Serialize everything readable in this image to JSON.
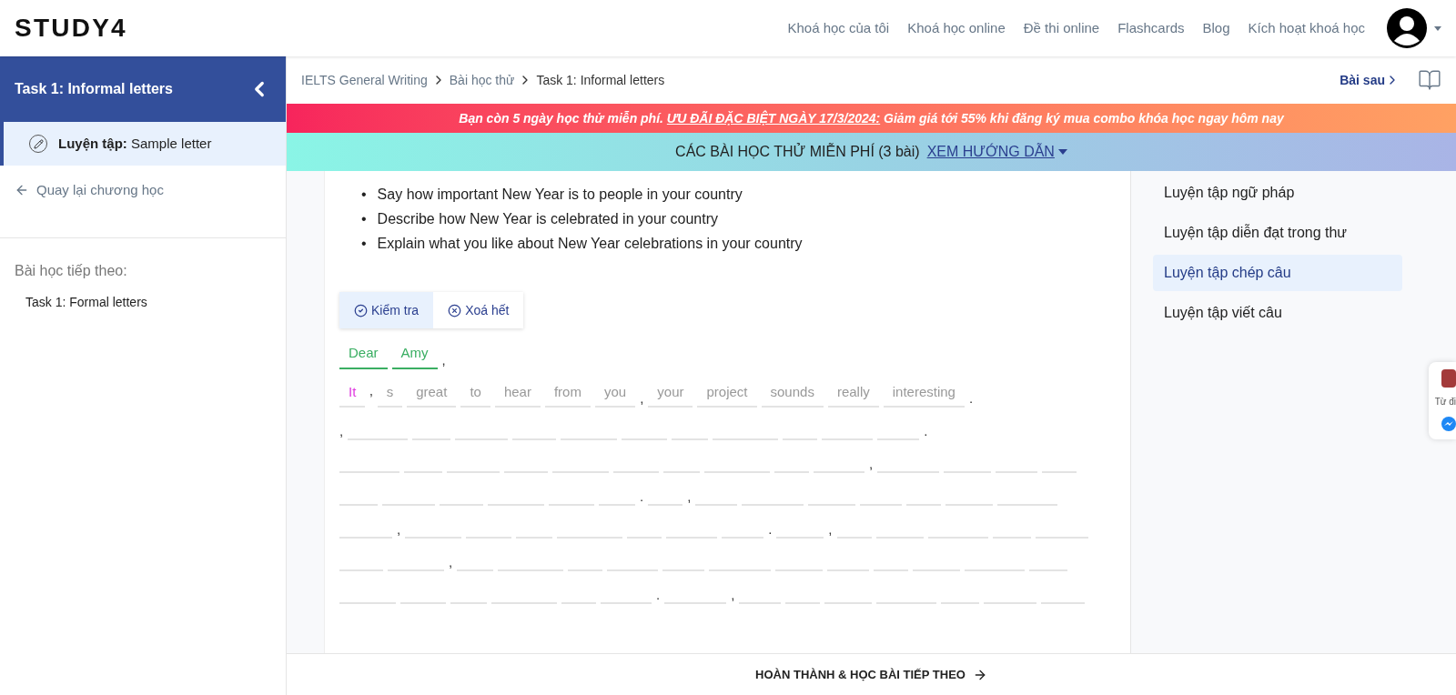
{
  "header": {
    "logo": "STUDY4",
    "nav": [
      "Khoá học của tôi",
      "Khoá học online",
      "Đề thi online",
      "Flashcards",
      "Blog",
      "Kích hoạt khoá học"
    ]
  },
  "sidebar": {
    "title": "Task 1: Informal letters",
    "items": [
      {
        "label": "Luyện tập:",
        "text": "Sample letter",
        "selected": true
      }
    ],
    "back": "Quay lại chương học",
    "next_heading": "Bài học tiếp theo:",
    "next_items": [
      "Task 1: Formal letters"
    ]
  },
  "breadcrumb": [
    "IELTS General Writing",
    "Bài học thử",
    "Task 1: Informal letters"
  ],
  "next_link": "Bài sau",
  "promo": {
    "text": "Bạn còn 5 ngày học thử miễn phí. ",
    "link": "ƯU ĐÃI ĐẶC BIỆT NGÀY 17/3/2024:",
    "rest": " Giảm giá tới 55% khi đăng ký mua combo khóa học ngay hôm nay"
  },
  "trial_bar": {
    "text": "CÁC BÀI HỌC THỬ MIỄN PHÍ (3 bài)",
    "link": "XEM HƯỚNG DẪN"
  },
  "bullets": [
    {
      "marker": "•",
      "text": "Say how important New Year is to people in your country"
    },
    {
      "marker": "•",
      "text": "Describe how New Year is celebrated in your country"
    },
    {
      "marker": "•",
      "text": "Explain what you like about New Year celebrations in your country"
    }
  ],
  "actions": [
    {
      "label": "Kiểm tra",
      "kind": "check",
      "selected": true
    },
    {
      "label": "Xoá hết",
      "kind": "clear",
      "selected": false
    }
  ],
  "lines": [
    [
      {
        "kind": "word",
        "text": "Dear",
        "correct": true,
        "active": false
      },
      {
        "kind": "word",
        "text": "Amy",
        "correct": true,
        "active": false
      },
      {
        "kind": "mark",
        "text": ","
      }
    ],
    [
      {
        "kind": "word",
        "text": "It",
        "correct": false,
        "active": true
      },
      {
        "kind": "mark",
        "text": "’"
      },
      {
        "kind": "word",
        "text": "s",
        "correct": false,
        "active": false
      },
      {
        "kind": "word",
        "text": "great",
        "correct": false,
        "active": false
      },
      {
        "kind": "word",
        "text": "to",
        "correct": false,
        "active": false
      },
      {
        "kind": "word",
        "text": "hear",
        "correct": false,
        "active": false
      },
      {
        "kind": "word",
        "text": "from",
        "correct": false,
        "active": false
      },
      {
        "kind": "word",
        "text": "you",
        "correct": false,
        "active": false
      },
      {
        "kind": "mark",
        "text": ","
      },
      {
        "kind": "word",
        "text": "your",
        "correct": false,
        "active": false
      },
      {
        "kind": "word",
        "text": "project",
        "correct": false,
        "active": false
      },
      {
        "kind": "word",
        "text": "sounds",
        "correct": false,
        "active": false
      },
      {
        "kind": "word",
        "text": "really",
        "correct": false,
        "active": false
      },
      {
        "kind": "word",
        "text": "interesting",
        "correct": false,
        "active": false
      },
      {
        "kind": "mark",
        "text": "."
      }
    ],
    [
      {
        "kind": "mark",
        "text": ","
      },
      {
        "kind": "blank"
      },
      {
        "kind": "blank"
      },
      {
        "kind": "blank"
      },
      {
        "kind": "blank"
      },
      {
        "kind": "blank"
      },
      {
        "kind": "blank"
      },
      {
        "kind": "blank"
      },
      {
        "kind": "blank"
      },
      {
        "kind": "blank"
      },
      {
        "kind": "blank"
      },
      {
        "kind": "blank"
      },
      {
        "kind": "mark",
        "text": "."
      }
    ],
    [
      {
        "kind": "blank"
      },
      {
        "kind": "blank"
      },
      {
        "kind": "blank"
      },
      {
        "kind": "blank"
      },
      {
        "kind": "blank"
      },
      {
        "kind": "blank"
      },
      {
        "kind": "blank"
      },
      {
        "kind": "blank"
      },
      {
        "kind": "blank"
      },
      {
        "kind": "blank"
      },
      {
        "kind": "mark",
        "text": ","
      },
      {
        "kind": "blank"
      },
      {
        "kind": "blank"
      },
      {
        "kind": "blank"
      },
      {
        "kind": "blank"
      }
    ],
    [
      {
        "kind": "blank"
      },
      {
        "kind": "blank"
      },
      {
        "kind": "blank"
      },
      {
        "kind": "blank"
      },
      {
        "kind": "blank"
      },
      {
        "kind": "blank"
      },
      {
        "kind": "mark",
        "text": "."
      },
      {
        "kind": "blank"
      },
      {
        "kind": "mark",
        "text": ","
      },
      {
        "kind": "blank"
      },
      {
        "kind": "blank"
      },
      {
        "kind": "blank"
      },
      {
        "kind": "blank"
      },
      {
        "kind": "blank"
      },
      {
        "kind": "blank"
      },
      {
        "kind": "blank"
      }
    ],
    [
      {
        "kind": "blank"
      },
      {
        "kind": "mark",
        "text": ","
      },
      {
        "kind": "blank"
      },
      {
        "kind": "blank"
      },
      {
        "kind": "blank"
      },
      {
        "kind": "blank"
      },
      {
        "kind": "blank"
      },
      {
        "kind": "blank"
      },
      {
        "kind": "blank"
      },
      {
        "kind": "mark",
        "text": "."
      },
      {
        "kind": "blank"
      },
      {
        "kind": "mark",
        "text": ","
      },
      {
        "kind": "blank"
      },
      {
        "kind": "blank"
      },
      {
        "kind": "blank"
      },
      {
        "kind": "blank"
      },
      {
        "kind": "blank"
      }
    ],
    [
      {
        "kind": "blank"
      },
      {
        "kind": "blank"
      },
      {
        "kind": "mark",
        "text": ","
      },
      {
        "kind": "blank"
      },
      {
        "kind": "blank"
      },
      {
        "kind": "blank"
      },
      {
        "kind": "blank"
      },
      {
        "kind": "blank"
      },
      {
        "kind": "blank"
      },
      {
        "kind": "blank"
      },
      {
        "kind": "blank"
      },
      {
        "kind": "blank"
      },
      {
        "kind": "blank"
      },
      {
        "kind": "blank"
      },
      {
        "kind": "blank"
      }
    ],
    [
      {
        "kind": "blank"
      },
      {
        "kind": "blank"
      },
      {
        "kind": "blank"
      },
      {
        "kind": "blank"
      },
      {
        "kind": "blank"
      },
      {
        "kind": "blank"
      },
      {
        "kind": "mark",
        "text": "."
      },
      {
        "kind": "blank"
      },
      {
        "kind": "mark",
        "text": ","
      },
      {
        "kind": "blank"
      },
      {
        "kind": "blank"
      },
      {
        "kind": "blank"
      },
      {
        "kind": "blank"
      },
      {
        "kind": "blank"
      },
      {
        "kind": "blank"
      },
      {
        "kind": "blank"
      }
    ]
  ],
  "toc": [
    {
      "label": "Luyện tập ngữ pháp",
      "selected": false
    },
    {
      "label": "Luyện tập diễn đạt trong thư",
      "selected": false
    },
    {
      "label": "Luyện tập chép câu",
      "selected": true
    },
    {
      "label": "Luyện tập viết câu",
      "selected": false
    }
  ],
  "widget": {
    "dictionary": "Từ đi"
  },
  "footer_button": "HOÀN THÀNH & HỌC BÀI TIẾP THEO"
}
